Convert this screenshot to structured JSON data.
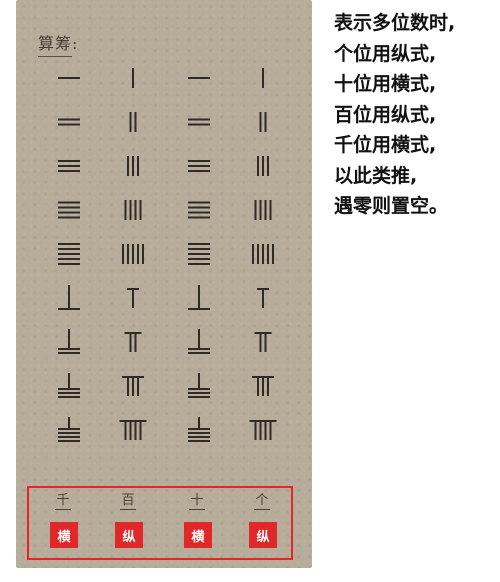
{
  "heading": "算筹:",
  "columns": [
    "heng",
    "zong",
    "heng",
    "zong"
  ],
  "digits": [
    1,
    2,
    3,
    4,
    5,
    6,
    7,
    8,
    9
  ],
  "place_labels": [
    "千",
    "百",
    "十",
    "个"
  ],
  "badges": [
    "横",
    "纵",
    "横",
    "纵"
  ],
  "rules": [
    "表示多位数时,",
    "个位用纵式,",
    "十位用横式,",
    "百位用纵式,",
    "千位用横式,",
    "以此类推,",
    "遇零则置空。"
  ],
  "colors": {
    "paper": "#b7ab9a",
    "ink": "#2f2a25",
    "accent": "#e0282b"
  }
}
